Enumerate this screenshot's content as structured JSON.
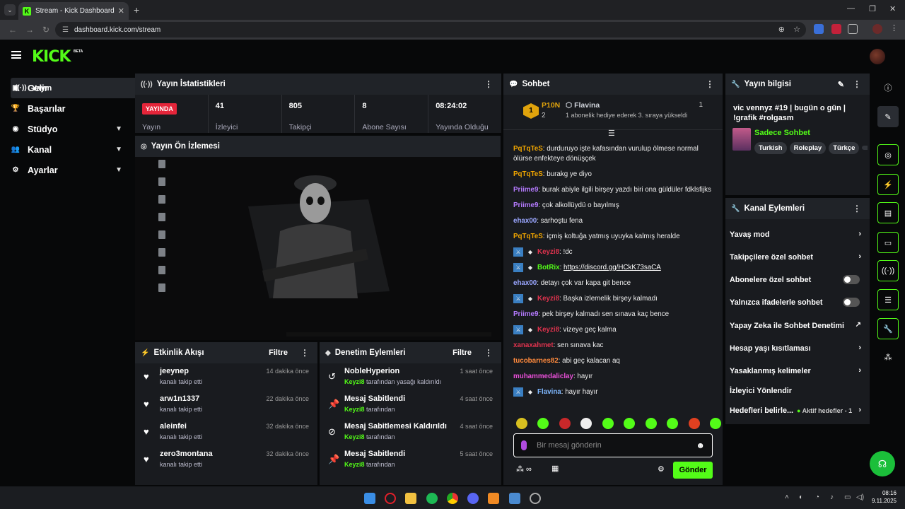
{
  "browser": {
    "tab_title": "Stream - Kick Dashboard",
    "url": "dashboard.kick.com/stream"
  },
  "logo": "KICK",
  "beta": "BETA",
  "sidebar": {
    "items": [
      {
        "label": "Yayın",
        "icon": "broadcast-icon",
        "active": true,
        "expand": false
      },
      {
        "label": "Gelir",
        "icon": "wallet-icon",
        "active": false,
        "expand": false
      },
      {
        "label": "Başarılar",
        "icon": "trophy-icon",
        "active": false,
        "expand": false
      },
      {
        "label": "Stüdyo",
        "icon": "studio-icon",
        "active": false,
        "expand": true
      },
      {
        "label": "Kanal",
        "icon": "people-icon",
        "active": false,
        "expand": true
      },
      {
        "label": "Ayarlar",
        "icon": "gear-icon",
        "active": false,
        "expand": true
      }
    ]
  },
  "stats": {
    "title": "Yayın İstatistikleri",
    "live_badge": "YAYINDA",
    "items": [
      {
        "value": "",
        "label": "Yayın"
      },
      {
        "value": "41",
        "label": "İzleyici"
      },
      {
        "value": "805",
        "label": "Takipçi"
      },
      {
        "value": "8",
        "label": "Abone Sayısı"
      },
      {
        "value": "08:24:02",
        "label": "Yayında Olduğu Süre"
      }
    ]
  },
  "preview": {
    "title": "Yayın Ön İzlemesi"
  },
  "events": {
    "title": "Etkinlik Akışı",
    "filter": "Filtre",
    "items": [
      {
        "name": "jeeynep",
        "sub": "kanalı takip etti",
        "time": "14 dakika önce"
      },
      {
        "name": "arw1n1337",
        "sub": "kanalı takip etti",
        "time": "22 dakika önce"
      },
      {
        "name": "aleinfei",
        "sub": "kanalı takip etti",
        "time": "32 dakika önce"
      },
      {
        "name": "zero3montana",
        "sub": "kanalı takip etti",
        "time": "32 dakika önce"
      }
    ]
  },
  "moderation": {
    "title": "Denetim Eylemleri",
    "filter": "Filtre",
    "items": [
      {
        "name": "NobleHyperion",
        "user": "Keyzi8",
        "sub": " tarafından yasağı kaldırıldı",
        "time": "1 saat önce",
        "icon": "undo-icon"
      },
      {
        "name": "Mesaj Sabitlendi",
        "user": "Keyzi8",
        "sub": " tarafından",
        "time": "4 saat önce",
        "icon": "pin-icon"
      },
      {
        "name": "Mesaj Sabitlemesi Kaldırıldı",
        "user": "Keyzi8",
        "sub": " tarafından",
        "time": "4 saat önce",
        "icon": "unpin-icon"
      },
      {
        "name": "Mesaj Sabitlendi",
        "user": "Keyzi8",
        "sub": " tarafından",
        "time": "5 saat önce",
        "icon": "pin-icon"
      }
    ]
  },
  "chat": {
    "title": "Sohbet",
    "pinned": {
      "rank": "1",
      "user": "P10N",
      "count": "2",
      "gifter": "Flavina",
      "gift_count": "1",
      "text": "1 abonelik hediye ederek 3. sıraya yükseldi"
    },
    "messages": [
      {
        "user": "PqTqTeS",
        "color": "#f0a500",
        "text": "durduruyo işte kafasından vurulup ölmese normal ölürse enfekteye dönüşçek",
        "badges": 0
      },
      {
        "user": "PqTqTeS",
        "color": "#f0a500",
        "text": "burakg ye diyo",
        "badges": 0
      },
      {
        "user": "Priime9",
        "color": "#b57bff",
        "text": "burak abiyle ilgili birşey yazdı biri ona güldüler fdklsfijks",
        "badges": 0
      },
      {
        "user": "Priime9",
        "color": "#b57bff",
        "text": "çok alkollüydü o bayılmış",
        "badges": 0
      },
      {
        "user": "ehax00",
        "color": "#9aa6ff",
        "text": "sarhoştu fena",
        "badges": 0
      },
      {
        "user": "PqTqTeS",
        "color": "#f0a500",
        "text": "içmiş koltuğa yatmış uyuyka kalmış heralde",
        "badges": 0
      },
      {
        "user": "Keyzi8",
        "color": "#e0334e",
        "text": "!dc",
        "badges": 2
      },
      {
        "user": "BotRix",
        "color": "#53fc18",
        "text": "",
        "link": "https://discord.gg/HCkK73saCA",
        "badges": 2
      },
      {
        "user": "ehax00",
        "color": "#9aa6ff",
        "text": "detayı çok var kapa git bence",
        "badges": 0
      },
      {
        "user": "Keyzi8",
        "color": "#e0334e",
        "text": "Başka izlemelik birşey kalmadı",
        "badges": 2
      },
      {
        "user": "Priime9",
        "color": "#b57bff",
        "text": "pek birşey kalmadı sen sınava kaç bence",
        "badges": 0
      },
      {
        "user": "Keyzi8",
        "color": "#e0334e",
        "text": "vizeye geç kalma",
        "badges": 2
      },
      {
        "user": "xanaxahmet",
        "color": "#e0334e",
        "text": "sen sınava kac",
        "badges": 0
      },
      {
        "user": "tucobarnes82",
        "color": "#ff8a3d",
        "text": "abi geç kalacan aq",
        "badges": 0
      },
      {
        "user": "muhammedaliclay",
        "color": "#e94fd8",
        "text": "hayır",
        "badges": 0
      },
      {
        "user": "Flavina",
        "color": "#7fb8ff",
        "text": "hayır hayır",
        "badges": 2
      }
    ],
    "placeholder": "Bir mesaj gönderin",
    "send": "Gönder"
  },
  "info": {
    "title": "Yayın bilgisi",
    "stream_title": "vic vennyz #19 | bugün o gün | !grafik #rolgasm",
    "mode": "Sadece Sohbet",
    "tags": [
      "Turkish",
      "Roleplay",
      "Türkçe"
    ]
  },
  "actions": {
    "title": "Kanal Eylemleri",
    "items": [
      {
        "label": "Yavaş mod",
        "kind": "chev"
      },
      {
        "label": "Takipçilere özel sohbet",
        "kind": "chev"
      },
      {
        "label": "Abonelere özel sohbet",
        "kind": "toggle"
      },
      {
        "label": "Yalnızca ifadelerle sohbet",
        "kind": "toggle"
      },
      {
        "label": "Yapay Zeka ile Sohbet Denetimi",
        "kind": "ext"
      },
      {
        "label": "Hesap yaşı kısıtlaması",
        "kind": "chev"
      },
      {
        "label": "Yasaklanmış kelimeler",
        "kind": "chev"
      },
      {
        "label": "İzleyici Yönlendir",
        "kind": "none"
      },
      {
        "label": "Hedefleri belirle...",
        "kind": "chev",
        "extra": "Aktif hedefler - 1"
      }
    ]
  },
  "clock": {
    "time": "08:16",
    "date": "9.11.2025"
  },
  "colors": {
    "accent": "#53fc18",
    "live": "#e5253a",
    "panel": "#191b1f"
  }
}
